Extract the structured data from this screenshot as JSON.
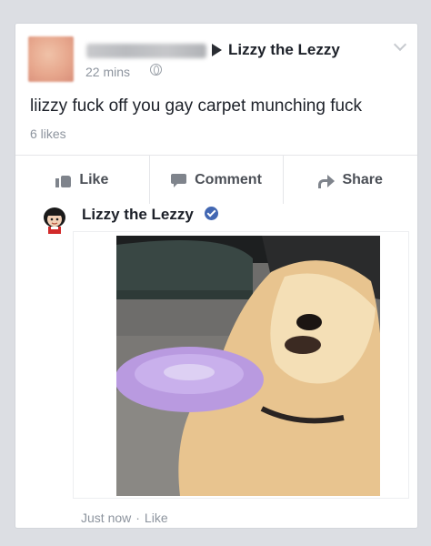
{
  "post": {
    "target_name": "Lizzy the Lezzy",
    "time": "22 mins",
    "text": "liizzy fuck off you gay carpet munching fuck",
    "likes": "6 likes"
  },
  "actions": {
    "like": "Like",
    "comment": "Comment",
    "share": "Share"
  },
  "comment": {
    "author": "Lizzy the Lezzy",
    "time": "Just now",
    "separator": "·",
    "like": "Like"
  },
  "colors": {
    "verified": "#4267b2",
    "meta_text": "#8d949e",
    "action_text": "#4b4f56"
  }
}
